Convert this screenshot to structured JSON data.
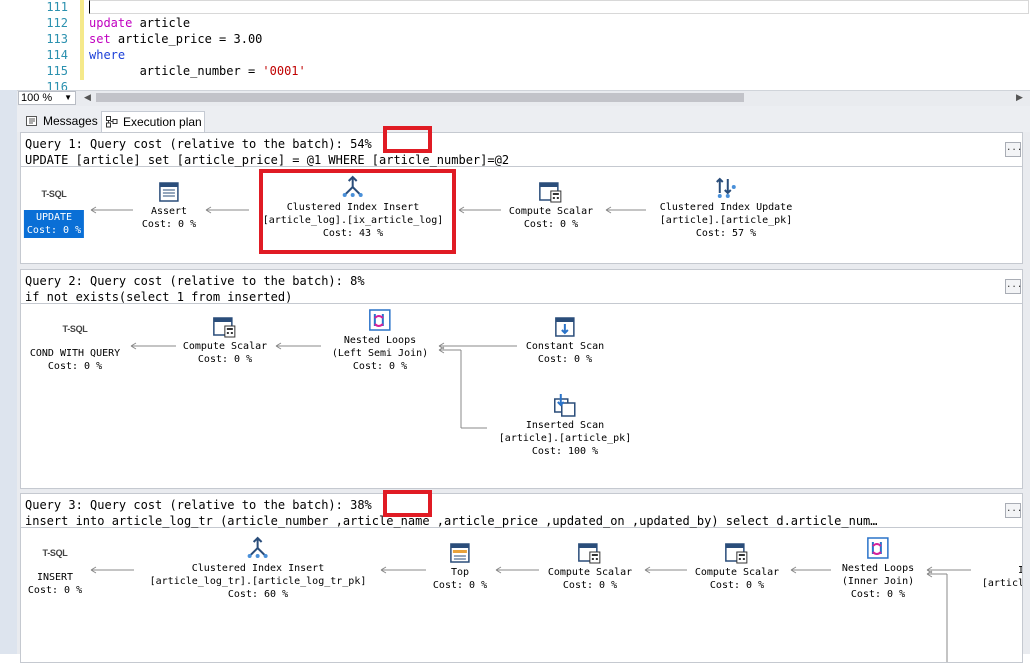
{
  "editor": {
    "lines": [
      {
        "num": "111",
        "text": ""
      },
      {
        "num": "112",
        "kw": "update",
        "rest": " article"
      },
      {
        "num": "113",
        "kw": "set",
        "rest": " article_price = 3.00"
      },
      {
        "num": "114",
        "kw2": "where",
        "rest": ""
      },
      {
        "num": "115",
        "indent": "       ",
        "rest": "article_number = ",
        "str": "'0001'"
      },
      {
        "num": "116",
        "text": ""
      }
    ]
  },
  "zoom": {
    "value": "100 %"
  },
  "tabs": {
    "messages": "Messages",
    "plan": "Execution plan"
  },
  "queries": [
    {
      "title": "Query 1: Query cost (relative to the batch): 54%",
      "sql": "UPDATE [article] set [article_price] = @1 WHERE [article_number]=@2",
      "nodes": {
        "tsql": "T-SQL",
        "update": [
          "UPDATE",
          "Cost: 0 %"
        ],
        "assert": [
          "Assert",
          "Cost: 0 %"
        ],
        "cii": [
          "Clustered Index Insert",
          "[article_log].[ix_article_log]",
          "Cost: 43 %"
        ],
        "cs": [
          "Compute Scalar",
          "Cost: 0 %"
        ],
        "ciu": [
          "Clustered Index Update",
          "[article].[article_pk]",
          "Cost: 57 %"
        ]
      }
    },
    {
      "title": "Query 2: Query cost (relative to the batch): 8%",
      "sql": "if not exists(select 1 from inserted)",
      "nodes": {
        "tsql": "T-SQL",
        "cond": [
          "COND WITH QUERY",
          "Cost: 0 %"
        ],
        "cs": [
          "Compute Scalar",
          "Cost: 0 %"
        ],
        "nl": [
          "Nested Loops",
          "(Left Semi Join)",
          "Cost: 0 %"
        ],
        "const": [
          "Constant Scan",
          "Cost: 0 %"
        ],
        "ins": [
          "Inserted Scan",
          "[article].[article_pk]",
          "Cost: 100 %"
        ]
      }
    },
    {
      "title": "Query 3: Query cost (relative to the batch): 38%",
      "sql": "insert into article_log_tr (article_number ,article_name ,article_price ,updated_on ,updated_by) select d.article_num…",
      "nodes": {
        "tsql": "T-SQL",
        "insert": [
          "INSERT",
          "Cost: 0 %"
        ],
        "cii": [
          "Clustered Index Insert",
          "[article_log_tr].[article_log_tr_pk]",
          "Cost: 60 %"
        ],
        "top": [
          "Top",
          "Cost: 0 %"
        ],
        "cs1": [
          "Compute Scalar",
          "Cost: 0 %"
        ],
        "cs2": [
          "Compute Scalar",
          "Cost: 0 %"
        ],
        "nl": [
          "Nested Loops",
          "(Inner Join)",
          "Cost: 0 %"
        ],
        "cut": [
          "I",
          "[articl"
        ]
      }
    }
  ],
  "more_label": "...",
  "colors": {
    "accent": "#0a6fd6",
    "highlight": "#e01b24"
  }
}
